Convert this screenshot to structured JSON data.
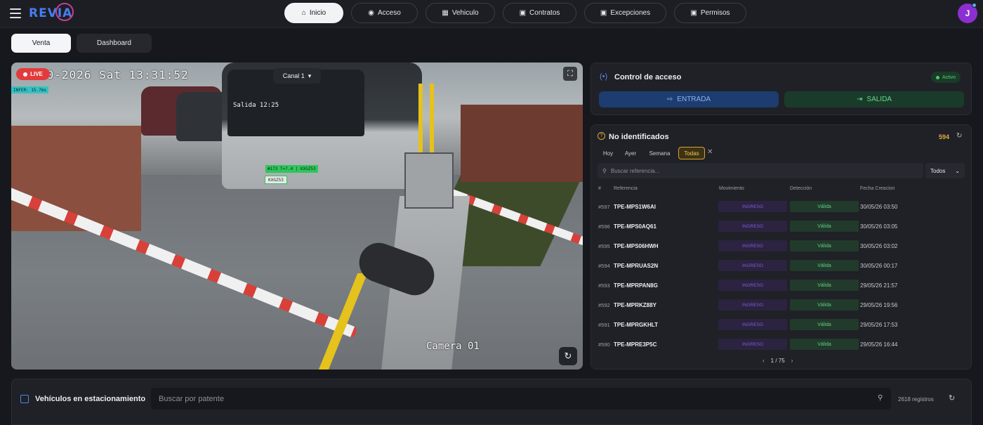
{
  "app": {
    "logo": "REVIA",
    "avatar_initial": "J"
  },
  "nav": [
    {
      "label": "Inicio",
      "icon": "home-icon",
      "active": true
    },
    {
      "label": "Acceso",
      "icon": "user-circle-icon"
    },
    {
      "label": "Vehiculo",
      "icon": "grid-icon"
    },
    {
      "label": "Contratos",
      "icon": "document-icon"
    },
    {
      "label": "Excepciones",
      "icon": "document-icon"
    },
    {
      "label": "Permisos",
      "icon": "document-icon"
    }
  ],
  "subtabs": {
    "venta": "Venta",
    "dashboard": "Dashboard"
  },
  "camera": {
    "live_label": "LIVE",
    "infer_label": "INFER: 15.7ms",
    "channel_label": "Canal 1",
    "date_overlay": "30-2026 Sat 13:31:52",
    "camera_name": "Camera 01",
    "plate_label": "#173 T=7.4 | KXGZ53",
    "plate_text": "KXGZ53",
    "bus_sign": "Salida 12:25"
  },
  "control": {
    "title": "Control de acceso",
    "status": "Activo",
    "entrada": "ENTRADA",
    "salida": "SALIDA"
  },
  "no_identificados": {
    "title": "No identificados",
    "count": "594",
    "filters": [
      "Hoy",
      "Ayer",
      "Semana",
      "Todas"
    ],
    "selected_filter": "Todas",
    "search_placeholder": "Buscar referencia...",
    "select_value": "Todos",
    "columns": [
      "#",
      "Referencia",
      "Movimiento",
      "Detección",
      "Fecha Creacion"
    ],
    "rows": [
      {
        "num": "#597",
        "ref": "TPE-MPS1W6AI",
        "mov": "INGRESO",
        "det": "Válida",
        "fecha": "30/05/26 03:50"
      },
      {
        "num": "#596",
        "ref": "TPE-MPS0AQ61",
        "mov": "INGRESO",
        "det": "Válida",
        "fecha": "30/05/26 03:05"
      },
      {
        "num": "#595",
        "ref": "TPE-MPS06HWH",
        "mov": "INGRESO",
        "det": "Válida",
        "fecha": "30/05/26 03:02"
      },
      {
        "num": "#594",
        "ref": "TPE-MPRUAS2N",
        "mov": "INGRESO",
        "det": "Válida",
        "fecha": "30/05/26 00:17"
      },
      {
        "num": "#593",
        "ref": "TPE-MPRPAN8G",
        "mov": "INGRESO",
        "det": "Válida",
        "fecha": "29/05/26 21:57"
      },
      {
        "num": "#592",
        "ref": "TPE-MPRKZ88Y",
        "mov": "INGRESO",
        "det": "Válida",
        "fecha": "29/05/26 19:56"
      },
      {
        "num": "#591",
        "ref": "TPE-MPRGKHLT",
        "mov": "INGRESO",
        "det": "Válida",
        "fecha": "29/05/26 17:53"
      },
      {
        "num": "#590",
        "ref": "TPE-MPRE3P5C",
        "mov": "INGRESO",
        "det": "Válida",
        "fecha": "29/05/26 16:44"
      }
    ],
    "pager": "1 / 75"
  },
  "estacionamiento": {
    "title": "Vehículos en estacionamiento",
    "search_placeholder": "Buscar por patente",
    "registros": "2618 registros"
  },
  "colors": {
    "accent": "#4a7cf0",
    "live": "#e33b3b",
    "warning": "#e7a93a",
    "ok": "#4fd37b"
  }
}
